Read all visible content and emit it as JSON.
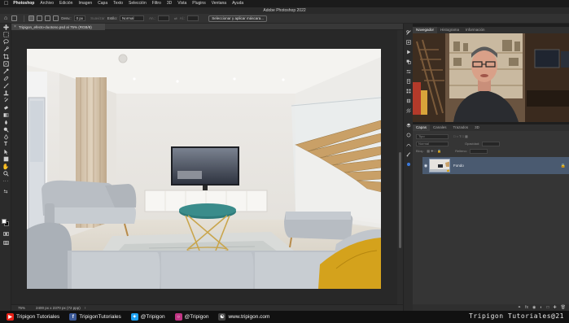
{
  "menubar": {
    "app": "Photoshop",
    "items": [
      "Archivo",
      "Edición",
      "Imagen",
      "Capa",
      "Texto",
      "Selección",
      "Filtro",
      "3D",
      "Vista",
      "Plugins",
      "Ventana",
      "Ayuda"
    ]
  },
  "window": {
    "title": "Adobe Photoshop 2022"
  },
  "options": {
    "feather_label": "Desv.:",
    "feather_value": "0 px",
    "smooth_label": "Suavizar",
    "style_label": "Estilo:",
    "style_value": "Normal",
    "width_label": "An.:",
    "height_label": "Al.:",
    "select_mask_button": "Seleccionar y aplicar máscara..."
  },
  "document": {
    "tab_title": "Tripigon_efecto-duotono.psd al 75% (RGB/8)",
    "zoom": "75%",
    "dimensions": "2400 px x 2370 px (72 ppp)"
  },
  "navigator": {
    "tabs": [
      "Navegador",
      "Histograma",
      "Información"
    ],
    "active": "Navegador"
  },
  "layers": {
    "tabs": [
      "Capas",
      "Canales",
      "Trazados",
      "3D"
    ],
    "active": "Capas",
    "filter_placeholder": "Tipo",
    "blend_mode": "Normal",
    "opacity_label": "Opacidad:",
    "lock_label": "Bloq.:",
    "fill_label": "Relleno:",
    "layer_name": "Fondo"
  },
  "footer": {
    "youtube": "Tripigon Tutoriales",
    "facebook": "TripigonTutoriales",
    "twitter": "@Tripigon",
    "instagram": "@Tripigon",
    "web": "www.tripigon.com",
    "brand": "Tripigon Tutoriales@21"
  },
  "colors": {
    "youtube": "#e62117",
    "facebook": "#3b5998",
    "twitter": "#1da1f2",
    "instagram": "#c13584",
    "layer_selected": "#4a5a70"
  }
}
